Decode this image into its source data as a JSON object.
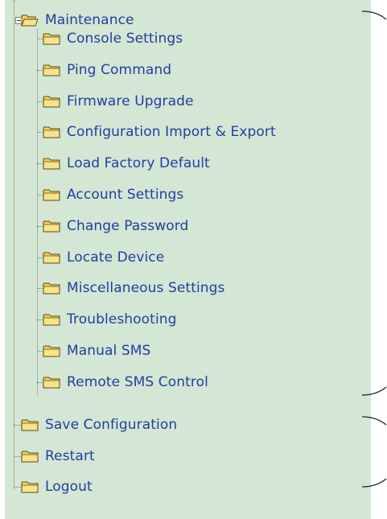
{
  "tree": {
    "root": {
      "label": "Maintenance",
      "expanded": true,
      "expander_icon": "minus-box-icon",
      "icon": "open-folder-icon",
      "children": [
        {
          "label": "Console Settings"
        },
        {
          "label": "Ping Command"
        },
        {
          "label": "Firmware Upgrade"
        },
        {
          "label": "Configuration Import & Export"
        },
        {
          "label": "Load Factory Default"
        },
        {
          "label": "Account Settings"
        },
        {
          "label": "Change Password"
        },
        {
          "label": "Locate Device"
        },
        {
          "label": "Miscellaneous Settings"
        },
        {
          "label": "Troubleshooting"
        },
        {
          "label": "Manual SMS"
        },
        {
          "label": "Remote SMS Control"
        }
      ]
    },
    "siblings": [
      {
        "label": "Save Configuration"
      },
      {
        "label": "Restart"
      },
      {
        "label": "Logout"
      }
    ],
    "child_icon": "folder-icon"
  },
  "colors": {
    "panel_background": "#d4e6d4",
    "link_text": "#1f3fa3",
    "folder_fill": "#f2d25a",
    "folder_outline": "#5a4a1a"
  }
}
